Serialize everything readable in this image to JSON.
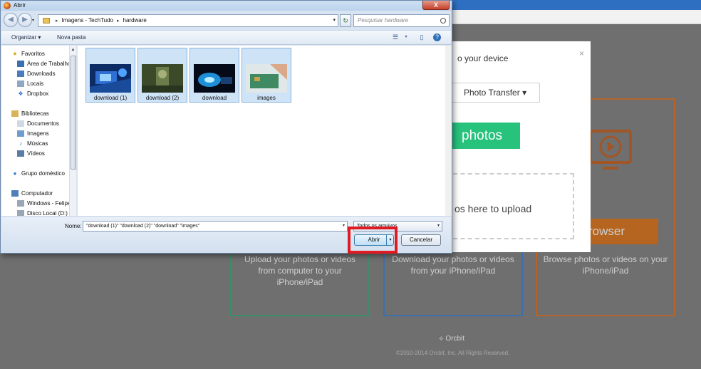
{
  "background": {
    "modal": {
      "title": "o your device",
      "close": "×",
      "select_label": "Photo Transfer",
      "green_button": "photos",
      "drop_text": "os here to upload"
    },
    "tiles": [
      {
        "text": "Upload your photos or videos from computer to your iPhone/iPad",
        "color": "#3a8f6b"
      },
      {
        "text": "Download your photos or videos from your iPhone/iPad",
        "color": "#3c6fae"
      },
      {
        "text": "Browse photos or videos on your iPhone/iPad",
        "button": "rowser",
        "color": "#b5652c"
      }
    ],
    "footer": {
      "logo": "Orcbit",
      "copyright": "©2010-2014 Orcbit, Inc. All Rights Reserved."
    }
  },
  "dialog": {
    "title": "Abrir",
    "close": "X",
    "address": {
      "parts": [
        "Imagens - TechTudo",
        "hardware"
      ]
    },
    "search_placeholder": "Pesquisar hardware",
    "toolbar": {
      "organize": "Organizar ▾",
      "new_folder": "Nova pasta"
    },
    "nav": {
      "favorites": "Favoritos",
      "favorites_items": [
        "Área de Trabalho",
        "Downloads",
        "Locais",
        "Dropbox"
      ],
      "libraries": "Bibliotecas",
      "libraries_items": [
        "Documentos",
        "Imagens",
        "Músicas",
        "Vídeos"
      ],
      "homegroup": "Grupo doméstico",
      "computer": "Computador",
      "computer_items": [
        "Windows - Felipe",
        "Disco Local (D:)"
      ]
    },
    "files": [
      {
        "name": "download (1)"
      },
      {
        "name": "download (2)"
      },
      {
        "name": "download"
      },
      {
        "name": "images"
      }
    ],
    "name_label": "Nome:",
    "name_value": "\"download (1)\" \"download (2)\" \"download\" \"images\"",
    "filter_value": "Todos os arquivos",
    "open_button": "Abrir",
    "cancel_button": "Cancelar"
  },
  "colors": {
    "accent_highlight": "#e01a22",
    "selected_tile": "#cfe3f7"
  }
}
